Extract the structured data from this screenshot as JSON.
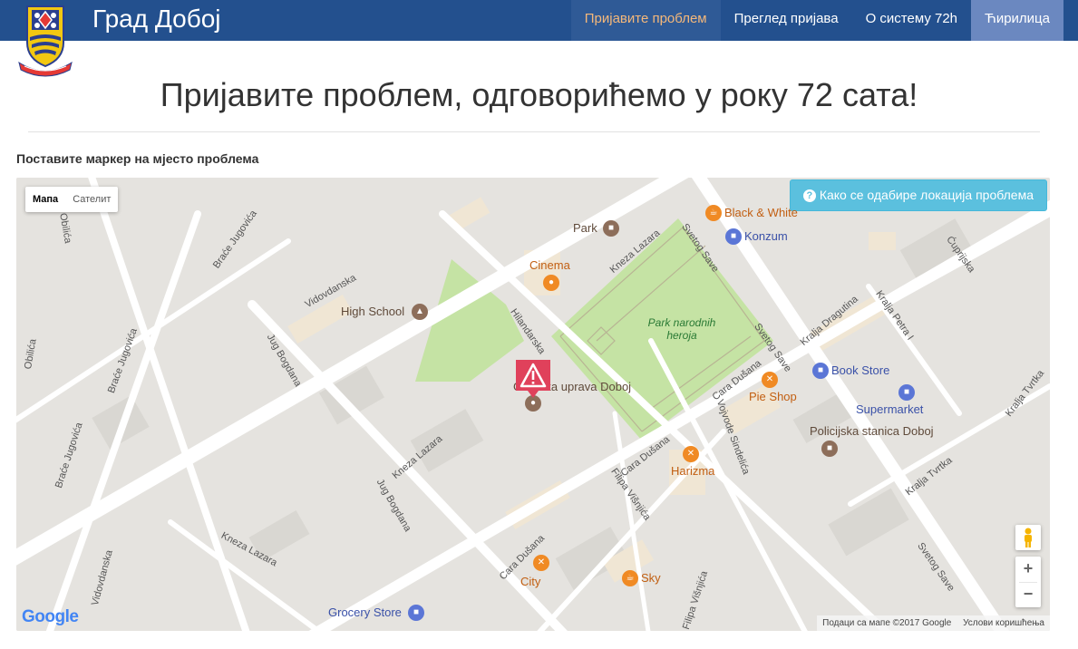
{
  "header": {
    "brand": "Град Добој",
    "nav": [
      {
        "label": "Пријавите проблем"
      },
      {
        "label": "Преглед пријава"
      },
      {
        "label": "О систему 72h"
      },
      {
        "label": "Ћирилица"
      }
    ]
  },
  "main": {
    "title": "Пријавите проблем, одговорићемо у року 72 сата!",
    "instruction": "Поставите маркер на мјесто проблема"
  },
  "map": {
    "type_options": [
      "Мапа",
      "Сателит"
    ],
    "help_button": "Како се одабире локација проблема",
    "zoom_in": "+",
    "zoom_out": "−",
    "google_logo": "Google",
    "attribution": "Подаци са мапе ©2017 Google",
    "terms": "Услови коришћења",
    "pois": {
      "park": "Park",
      "black_white": "Black & White",
      "konzum": "Konzum",
      "cinema": "Cinema",
      "high_school": "High School",
      "park_narodnih": "Park narodnih heroja",
      "gradska_uprava": "Gradska uprava Doboj",
      "book_store": "Book Store",
      "pie_shop": "Pie Shop",
      "supermarket": "Supermarket",
      "policija": "Policijska stanica Doboj",
      "harizma": "Harizma",
      "city": "City",
      "sky": "Sky",
      "grocery": "Grocery Store"
    },
    "streets": {
      "brace_jugovica": "Braće Jugovića",
      "vidovdanska": "Vidovdanska",
      "obilica": "Obilića",
      "jug_bogdana": "Jug Bogdana",
      "kneza_lazara": "Kneza Lazara",
      "hilandarska": "Hilandarska",
      "svetog_save": "Svetog Save",
      "cara_dusana": "Cara Dušana",
      "vojvode_sindelica": "Vojvode Sindelića",
      "filipa_visnjica": "Filipa Višnjića",
      "kralja_dragutina": "Kralja Dragutina",
      "kralja_petra": "Kralja Petra I",
      "kralja_tvrtka": "Kralja Tvrtka",
      "cuprijska": "Ćuprijska"
    }
  }
}
